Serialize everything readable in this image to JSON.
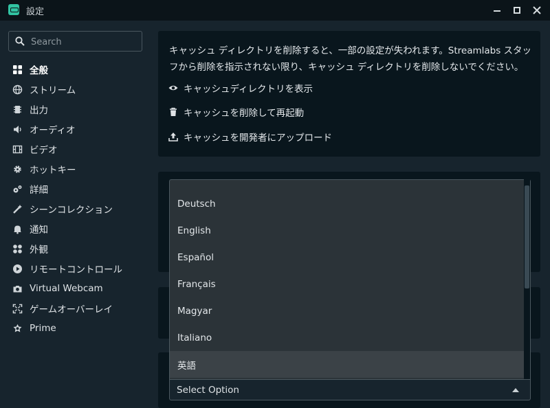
{
  "window": {
    "title": "設定"
  },
  "sidebar": {
    "search_placeholder": "Search",
    "items": [
      {
        "label": "全般",
        "icon": "grid-icon",
        "active": true
      },
      {
        "label": "ストリーム",
        "icon": "globe-icon"
      },
      {
        "label": "出力",
        "icon": "chip-icon"
      },
      {
        "label": "オーディオ",
        "icon": "speaker-icon"
      },
      {
        "label": "ビデオ",
        "icon": "film-icon"
      },
      {
        "label": "ホットキー",
        "icon": "gear-icon"
      },
      {
        "label": "詳細",
        "icon": "gears-icon"
      },
      {
        "label": "シーンコレクション",
        "icon": "magic-wand-icon"
      },
      {
        "label": "通知",
        "icon": "bell-icon"
      },
      {
        "label": "外観",
        "icon": "shapes-icon"
      },
      {
        "label": "リモートコントロール",
        "icon": "play-circle-icon"
      },
      {
        "label": "Virtual Webcam",
        "icon": "camera-icon"
      },
      {
        "label": "ゲームオーバーレイ",
        "icon": "expand-icon"
      },
      {
        "label": "Prime",
        "icon": "prime-icon"
      }
    ]
  },
  "cache": {
    "warning": "キャッシュ ディレクトリを削除すると、一部の設定が失われます。Streamlabs スタッフから削除を指示されない限り、キャッシュ ディレクトリを削除しないでください。",
    "show_dir": "キャッシュディレクトリを表示",
    "delete_restart": "キャッシュを削除して再起動",
    "upload": "キャッシュを開発者にアップロード"
  },
  "language_dropdown": {
    "options": [
      "Deutsch",
      "English",
      "Español",
      "Français",
      "Magyar",
      "Italiano",
      "英語"
    ],
    "highlighted": "英語",
    "select_placeholder": "Select Option"
  },
  "colors": {
    "background": "#17242d",
    "card": "#09161d",
    "accent": "#31c3a2"
  }
}
